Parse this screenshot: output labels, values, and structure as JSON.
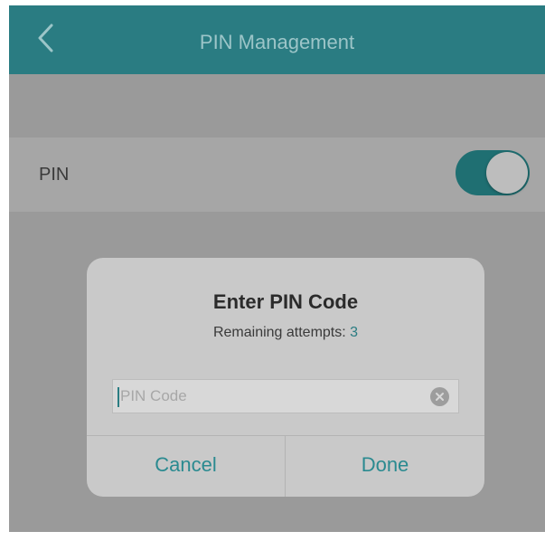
{
  "navbar": {
    "title": "PIN Management",
    "back_icon": "chevron-left-icon",
    "color": "#2a7c82"
  },
  "settings": {
    "pin_row": {
      "label": "PIN",
      "toggle_on": true
    }
  },
  "dialog": {
    "title": "Enter PIN Code",
    "remaining_label": "Remaining attempts:",
    "remaining_count": "3",
    "pin_input": {
      "placeholder": "PIN Code",
      "value": "",
      "clear_icon": "clear-icon"
    },
    "cancel_label": "Cancel",
    "done_label": "Done"
  },
  "colors": {
    "accent": "#2a8a90",
    "overlay": "#9a9a9a"
  }
}
